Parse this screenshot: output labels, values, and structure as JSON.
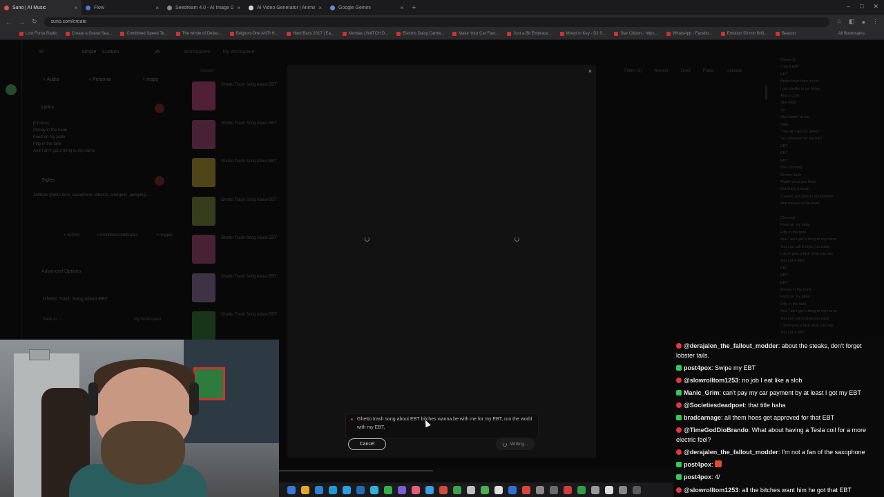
{
  "browser": {
    "tabs": [
      {
        "title": "Suno | AI Music",
        "color": "#e2553c"
      },
      {
        "title": "Flow",
        "color": "#4a7bd6"
      },
      {
        "title": "Seedream 4.0 - AI Image Gene",
        "color": "#888888"
      },
      {
        "title": "AI Video Generator | Animate",
        "color": "#d8d8d8"
      },
      {
        "title": "Google Gemini",
        "color": "#6a8ad6"
      }
    ],
    "new_tab": "+",
    "url": "suno.com/create",
    "bookmarks": [
      "Lost Force Radio",
      "Create a Grand Sea...",
      "Combined Speed Te...",
      "The whole of Defau...",
      "Belgium-One ANTI H...",
      "Hard Bass 2017 | Ea...",
      "Mordax | WATCH D...",
      "Electric Daisy Carniv...",
      "Make Your Car Fast...",
      "Just a Bit Embrace...",
      "Mixed in Key - DJ S...",
      "Star Citizen - https...",
      "WhatsApp - Facebo...",
      "Emotion 50 min Brill...",
      "Beacon"
    ],
    "all_bookmarks": "All Bookmarks"
  },
  "suno": {
    "counter": "50",
    "tab_simple": "Simple",
    "tab_custom": "Custom",
    "version": "v5",
    "btn_audio": "+ Audio",
    "btn_persona": "+ Persona",
    "btn_inspo": "+ Inspo",
    "lyrics_label": "Lyrics",
    "lyrics_text": "[Chorus]\nMoney in the bank\nFood on my plate\nFifty in the tank\nAnd I ain't got a thing to my name",
    "styles_label": "Styles",
    "styles_text": "150bpm ghetto tech, saxophone, intense, energetic, pumping...",
    "chips": [
      "+ techno",
      "+ bombfunkcelebrates",
      "+ reggae"
    ],
    "advanced": "Advanced Options",
    "song_title": "Ghetto Trash Song About EBT",
    "save_to": "Save to...",
    "my_workspace": "My Workspace",
    "workspaces": "Workspaces",
    "breadcrumb_ws": "My Workspace",
    "search_placeholder": "Search",
    "filters": [
      "Filters (3)",
      "Newest",
      "Liked",
      "Public",
      "Uploads"
    ],
    "songs": [
      {
        "title": "Ghetto Trash Song About EBT",
        "color": "#d94c8c"
      },
      {
        "title": "Ghetto Trash Song About EBT",
        "color": "#c4508c"
      },
      {
        "title": "Ghetto Trash Song About EBT",
        "color": "#d8b43a"
      },
      {
        "title": "Ghetto Trash Song About EBT",
        "color": "#8aa042"
      },
      {
        "title": "Ghetto Trash Song About EBT",
        "color": "#c0508a"
      },
      {
        "title": "Ghetto Trash Song About EBT",
        "color": "#a880b8"
      },
      {
        "title": "Ghetto Trash Song About EBT",
        "color": "#3a8a3a"
      }
    ],
    "right_lyrics": "[Verse 1]\nI need EBT\nEBT\nBroke boys hate on me\nI got steaks in my fridge\nAnd a cutie\nShe thick\nSo\nShe lookin' at me\nSaid\n\"You ain't got no green\"\nSo I showed her my EBT\nEBT\nEBT\nEBT\n[Pre-Chorus]\nGhetto trash\nThat's what you think\nBut that's a laugh\n'Causin' got cash in my pockets\nAnd money in the bank\n\n[Chorus]\nFood on my plate\nFifty in the tank\nAnd I ain't got a thing to my name\nYou can call it what you want\nI don't give a fuck what you say\nYou call it EBT\nEBT\nEBT\nEBT\nMoney in the bank\nFood on my plate\nFifty in the tank\nAnd I ain't got a thing to my name\nYou can call it what you want\nI don't give a fuck what you say\nYou call it EBT"
  },
  "modal": {
    "close": "×",
    "prompt": "Ghetto trash song about EBT bitches wanna be with me for my EBT, run the world with my EBT,",
    "cancel": "Cancel",
    "writing": "Writing..."
  },
  "chat": [
    {
      "user": "@derajalen_the_fallout_modder",
      "text": "about the steaks, don't forget lobster tails.",
      "badge": "mod"
    },
    {
      "user": "post4pox",
      "text": "Swipe my EBT",
      "badge": "vip"
    },
    {
      "user": "@slowrolltom1253",
      "text": "no job I eat like a slob",
      "badge": "mod"
    },
    {
      "user": "Manic_Grim",
      "text": "can't pay my car payment by at least I got my EBT",
      "badge": "vip"
    },
    {
      "user": "@Societiesdeadpoet",
      "text": "that title haha",
      "badge": "mod"
    },
    {
      "user": "bradcarnage",
      "text": "all them hoes get approved for that EBT",
      "badge": "vip"
    },
    {
      "user": "@TimeGodDioBrando",
      "text": "What about having a Tesla coil for a more electric feel?",
      "badge": "mod"
    },
    {
      "user": "@derajalen_the_fallout_modder",
      "text": "I'm not a fan of the saxophone",
      "badge": "mod"
    },
    {
      "user": "post4pox",
      "text": "",
      "badge": "vip",
      "emote": true
    },
    {
      "user": "post4pox",
      "text": "4/",
      "badge": "vip"
    },
    {
      "user": "@slowrolltom1253",
      "text": "all the bitches want him he got that EBT",
      "badge": "mod"
    }
  ],
  "taskbar_icons": [
    "#3b78d8",
    "#e0a82c",
    "#2a82d0",
    "#1d9bd7",
    "#28a0e8",
    "#1d6fb8",
    "#2fb3d8",
    "#34b24a",
    "#7a5fd0",
    "#e35c7a",
    "#3aa0e0",
    "#d24b3c",
    "#3ba34a",
    "#c0c0c0",
    "#4caf50",
    "#e0e0e0",
    "#2f6fd6",
    "#d9453b",
    "#8a8a8a",
    "#6a6a6a",
    "#d33c3c",
    "#2f9e44",
    "#9a9a9a",
    "#dddddd",
    "#888888",
    "#5a5a5a"
  ]
}
